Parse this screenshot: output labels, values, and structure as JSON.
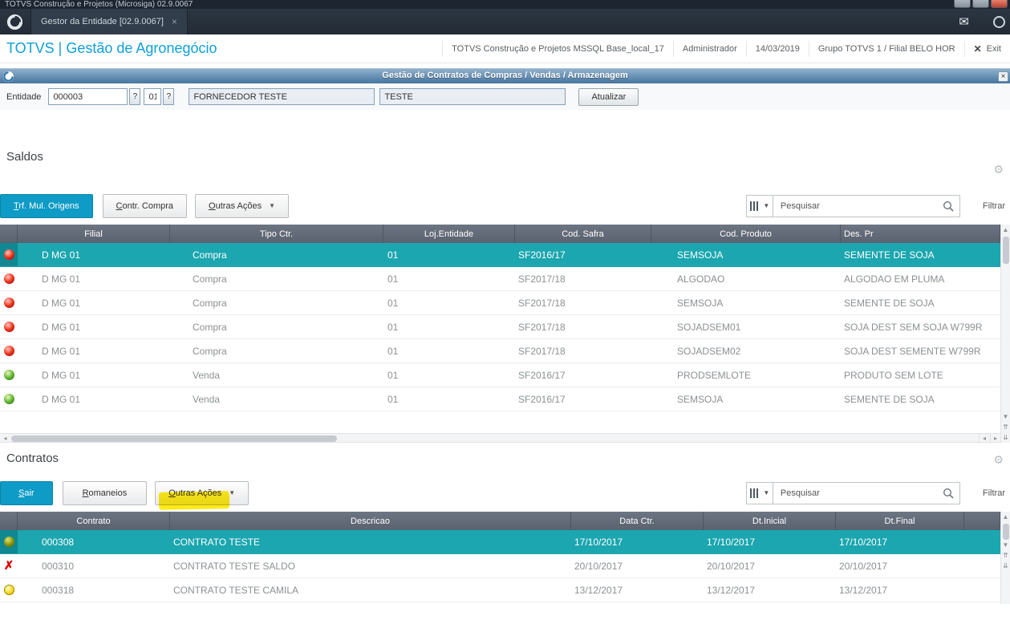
{
  "window": {
    "title": "TOTVS Construção e Projetos (Microsiga) 02.9.0067"
  },
  "tabbar": {
    "tab_label": "Gestor da Entidade [02.9.0067]"
  },
  "app_header": {
    "brand": "TOTVS | Gestão de Agronegócio",
    "environment": "TOTVS Construção e Projetos MSSQL Base_local_17",
    "user": "Administrador",
    "date": "14/03/2019",
    "branch": "Grupo TOTVS 1 / Filial BELO HOR",
    "exit_label": "Exit"
  },
  "dialog": {
    "title": "Gestão de Contratos de Compras / Vendas / Armazenagem"
  },
  "entity_form": {
    "label": "Entidade",
    "entity_code": "000003",
    "store_code": "01",
    "entity_name": "FORNECEDOR TESTE",
    "entity_shortname": "TESTE",
    "refresh_button": "Atualizar"
  },
  "saldos": {
    "title": "Saldos",
    "buttons": {
      "primary": "Trf. Mul. Origens",
      "secondary1": "Contr. Compra",
      "secondary2": "Outras Ações"
    },
    "search_placeholder": "Pesquisar",
    "filter_label": "Filtrar",
    "columns": [
      "Filial",
      "Tipo Ctr.",
      "Loj.Entidade",
      "Cod. Safra",
      "Cod. Produto",
      "Des. Pr"
    ],
    "rows": [
      {
        "selected": true,
        "status": "red",
        "filial": "D MG 01",
        "tipo": "Compra",
        "loja": "01",
        "safra": "SF2016/17",
        "produto": "SEMSOJA",
        "descricao": "SEMENTE DE SOJA"
      },
      {
        "selected": false,
        "status": "red",
        "filial": "D MG 01",
        "tipo": "Compra",
        "loja": "01",
        "safra": "SF2017/18",
        "produto": "ALGODAO",
        "descricao": "ALGODAO EM PLUMA"
      },
      {
        "selected": false,
        "status": "red",
        "filial": "D MG 01",
        "tipo": "Compra",
        "loja": "01",
        "safra": "SF2017/18",
        "produto": "SEMSOJA",
        "descricao": "SEMENTE DE SOJA"
      },
      {
        "selected": false,
        "status": "red",
        "filial": "D MG 01",
        "tipo": "Compra",
        "loja": "01",
        "safra": "SF2017/18",
        "produto": "SOJADSEM01",
        "descricao": "SOJA DEST SEM SOJA W799R"
      },
      {
        "selected": false,
        "status": "red",
        "filial": "D MG 01",
        "tipo": "Compra",
        "loja": "01",
        "safra": "SF2017/18",
        "produto": "SOJADSEM02",
        "descricao": "SOJA DEST SEMENTE W799R"
      },
      {
        "selected": false,
        "status": "green",
        "filial": "D MG 01",
        "tipo": "Venda",
        "loja": "01",
        "safra": "SF2016/17",
        "produto": "PRODSEMLOTE",
        "descricao": "PRODUTO SEM LOTE"
      },
      {
        "selected": false,
        "status": "green",
        "filial": "D MG 01",
        "tipo": "Venda",
        "loja": "01",
        "safra": "SF2016/17",
        "produto": "SEMSOJA",
        "descricao": "SEMENTE DE SOJA"
      }
    ]
  },
  "contratos": {
    "title": "Contratos",
    "buttons": {
      "primary": "Sair",
      "secondary1": "Romaneios",
      "secondary2": "Outras Ações"
    },
    "search_placeholder": "Pesquisar",
    "filter_label": "Filtrar",
    "columns": [
      "Contrato",
      "Descricao",
      "Data Ctr.",
      "Dt.Inicial",
      "Dt.Final"
    ],
    "rows": [
      {
        "selected": true,
        "status": "olive",
        "contrato": "000308",
        "descricao": "CONTRATO TESTE",
        "data_ctr": "17/10/2017",
        "dt_inicial": "17/10/2017",
        "dt_final": "17/10/2017"
      },
      {
        "selected": false,
        "status": "x",
        "contrato": "000310",
        "descricao": "CONTRATO TESTE SALDO",
        "data_ctr": "20/10/2017",
        "dt_inicial": "20/10/2017",
        "dt_final": "20/10/2017"
      },
      {
        "selected": false,
        "status": "yellow",
        "contrato": "000318",
        "descricao": "CONTRATO TESTE CAMILA",
        "data_ctr": "13/12/2017",
        "dt_inicial": "13/12/2017",
        "dt_final": "13/12/2017"
      }
    ]
  },
  "icons": {
    "gear": "⚙",
    "mail": "✉",
    "close": "×",
    "exit_x": "✕",
    "caret_down": "▼",
    "lookup": "?",
    "scroll_up": "▲",
    "scroll_down": "▼",
    "scroll_pgup": "⇈",
    "scroll_pgdn": "⇊",
    "scroll_left": "◂",
    "scroll_right": "▸"
  },
  "colors": {
    "accent_blue": "#0e9bc5",
    "selected_row": "#1ca6af",
    "brand_blue": "#0fa0da",
    "table_header_bg": "#636b79",
    "highlight_yellow": "#ffe800"
  }
}
